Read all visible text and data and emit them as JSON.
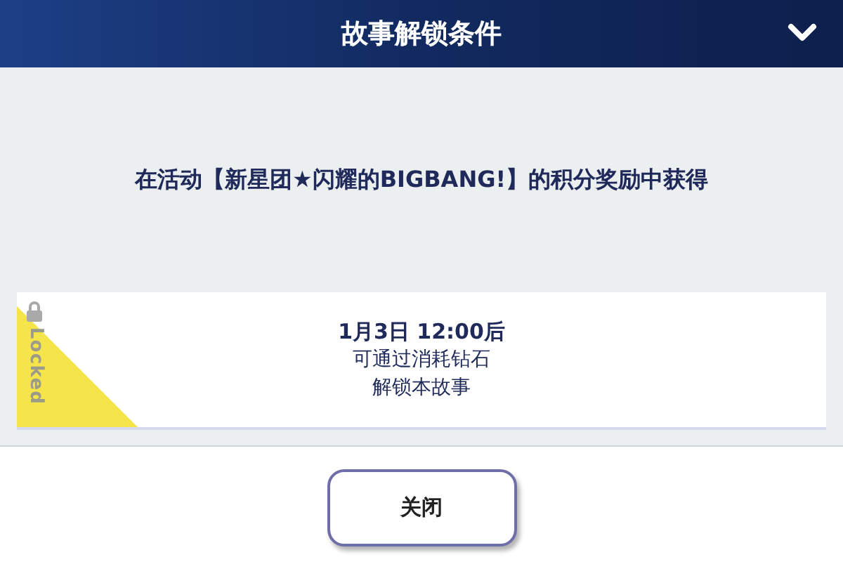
{
  "header": {
    "title": "故事解锁条件"
  },
  "condition": "在活动【新星团★闪耀的BIGBANG!】的积分奖励中获得",
  "card": {
    "locked": true,
    "badge": "Locked",
    "lines": [
      "1月3日 12:00后",
      "可通过消耗钻石",
      "解锁本故事"
    ]
  },
  "buttons": [
    "关闭"
  ]
}
